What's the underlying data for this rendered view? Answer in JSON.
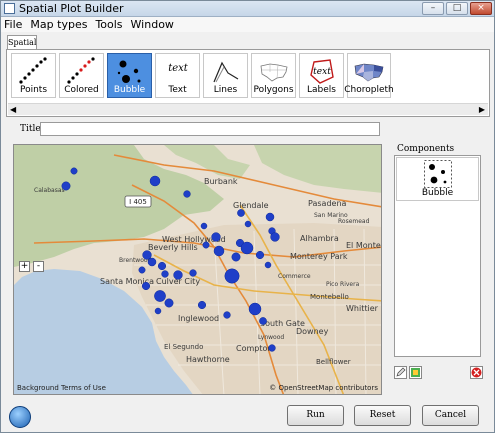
{
  "window": {
    "title": "Spatial Plot Builder",
    "app_icon": "map-app-icon"
  },
  "menu": [
    "File",
    "Map types",
    "Tools",
    "Window"
  ],
  "tab": "Spatial",
  "palette": {
    "items": [
      {
        "label": "Points",
        "icon": "points-icon",
        "selected": false
      },
      {
        "label": "Colored",
        "icon": "colored-points-icon",
        "selected": false
      },
      {
        "label": "Bubble",
        "icon": "bubble-icon",
        "selected": true
      },
      {
        "label": "Text",
        "icon": "text-icon",
        "selected": false
      },
      {
        "label": "Lines",
        "icon": "lines-icon",
        "selected": false
      },
      {
        "label": "Polygons",
        "icon": "polygons-icon",
        "selected": false
      },
      {
        "label": "Labels",
        "icon": "labels-icon",
        "selected": false
      },
      {
        "label": "Choropleth",
        "icon": "choropleth-icon",
        "selected": false
      }
    ],
    "icon_glyphs": {
      "text": "text"
    }
  },
  "title_field": {
    "label": "Title:",
    "value": ""
  },
  "map": {
    "zoom_in": "+",
    "zoom_out": "-",
    "highway_shield": "I 405",
    "places": [
      "Burbank",
      "Glendale",
      "Pasadena",
      "West Hollywood",
      "Beverly Hills",
      "Alhambra",
      "El Monte",
      "Monterey Park",
      "Santa Monica",
      "Culver City",
      "Inglewood",
      "Montebello",
      "Whittier",
      "South Gate",
      "Downey",
      "El Segundo",
      "Hawthorne",
      "Compton",
      "Bellflower",
      "Calabasas",
      "Brentwood",
      "Commerce",
      "Pico Rivera",
      "Rosemead",
      "San Marino",
      "Lynwood"
    ],
    "attribution_left": "Background Terms of Use",
    "attribution_right": "© OpenStreetMap contributors"
  },
  "components": {
    "label": "Components",
    "items": [
      {
        "label": "Bubble",
        "icon": "bubble-icon"
      }
    ]
  },
  "buttons": {
    "run": "Run",
    "reset": "Reset",
    "cancel": "Cancel"
  },
  "colors": {
    "accent": "#4d8fe0",
    "bubble": "#1f3fc8",
    "selected_text": "#ffffff"
  }
}
